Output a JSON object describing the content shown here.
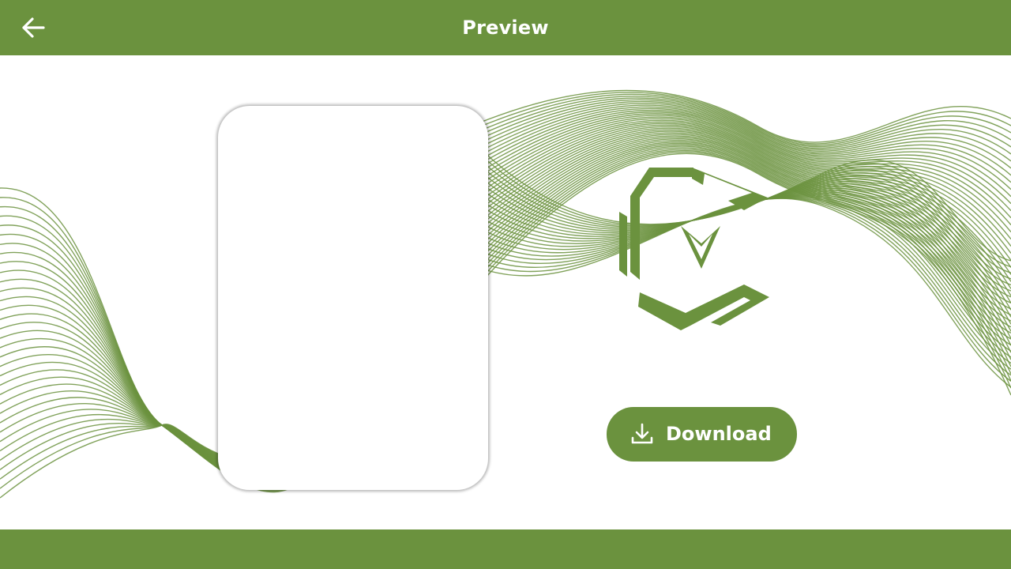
{
  "header": {
    "title": "Preview",
    "back_icon": "arrow-left-icon"
  },
  "main": {
    "download_label": "Download",
    "download_icon": "download-icon",
    "logo": "company-logo"
  },
  "colors": {
    "brand": "#6b923e",
    "background": "#ffffff",
    "text_on_brand": "#ffffff"
  }
}
